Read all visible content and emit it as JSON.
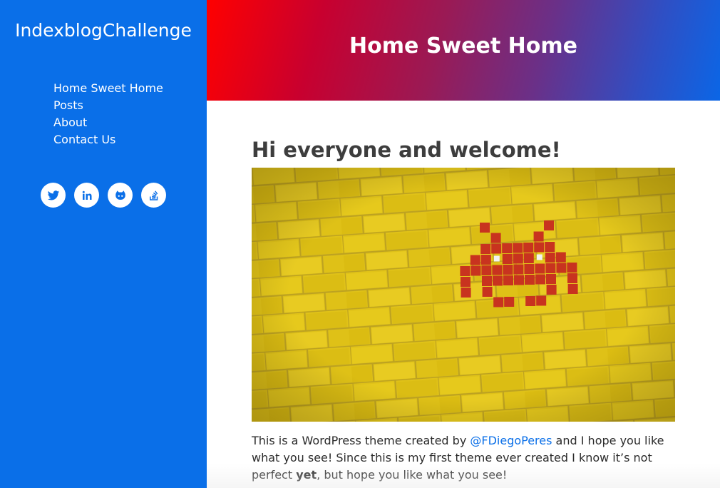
{
  "site": {
    "title": "IndexblogChallenge"
  },
  "nav": {
    "items": [
      {
        "label": "Home Sweet Home"
      },
      {
        "label": "Posts"
      },
      {
        "label": "About"
      },
      {
        "label": "Contact Us"
      }
    ]
  },
  "social": {
    "icons": [
      "twitter-icon",
      "linkedin-icon",
      "github-icon",
      "stackoverflow-icon"
    ]
  },
  "hero": {
    "title": "Home Sweet Home"
  },
  "post": {
    "title": "Hi everyone and welcome!",
    "image_subject": "space-invader-on-yellow-brick-wall",
    "text_1": "This is a WordPress theme created by ",
    "link": "@FDiegoPeres",
    "text_2": " and I hope you like what you see! Since this is my first theme ever created I know it’s not perfect ",
    "bold": "yet",
    "text_3": ", but hope you like what you see!"
  },
  "colors": {
    "sidebar": "#0a6fe8",
    "accent": "#0a6fe8",
    "brick_yellow": "#e2c417",
    "invader_red": "#c8331f"
  }
}
